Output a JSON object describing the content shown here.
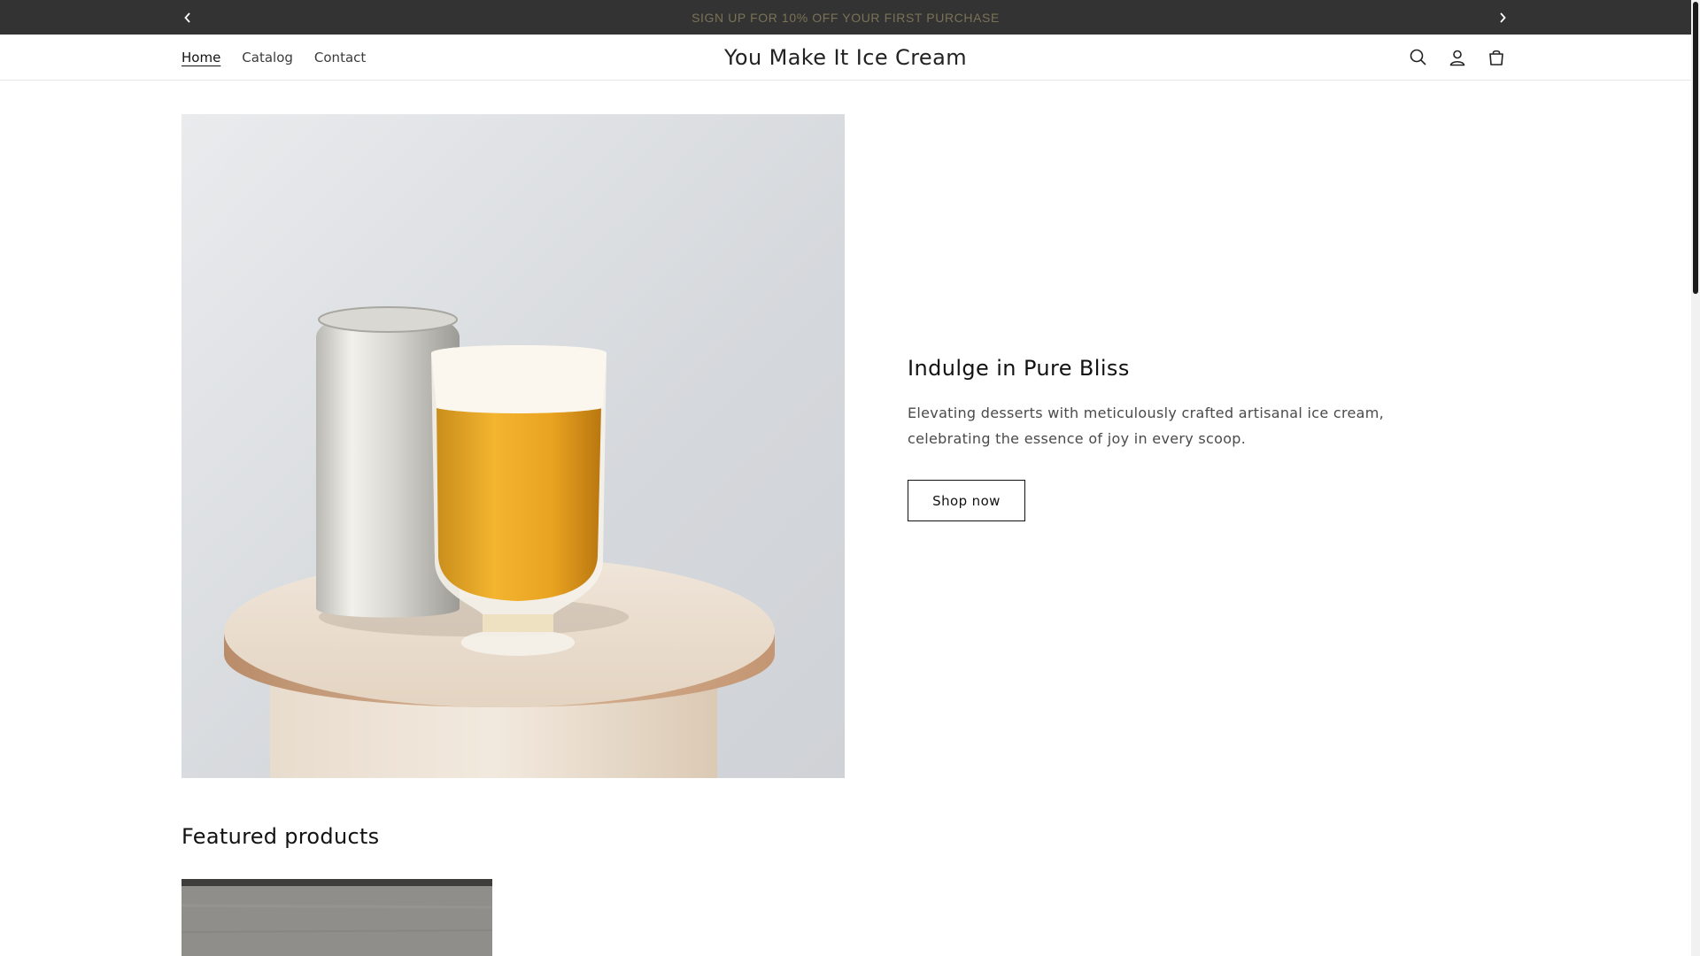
{
  "announcement": {
    "message": "SIGN UP FOR 10% OFF YOUR FIRST PURCHASE",
    "prev_icon": "chevron-left-icon",
    "next_icon": "chevron-right-icon",
    "background": "#333333",
    "text_color": "#7a7256"
  },
  "header": {
    "logo": "You Make It Ice Cream",
    "nav": [
      {
        "label": "Home",
        "active": true
      },
      {
        "label": "Catalog",
        "active": false
      },
      {
        "label": "Contact",
        "active": false
      }
    ],
    "icons": [
      "search-icon",
      "account-icon",
      "cart-icon"
    ]
  },
  "hero": {
    "image": "can-and-glass-of-beer-on-wooden-stand",
    "title": "Indulge in Pure Bliss",
    "description": "Elevating desserts with meticulously crafted artisanal ice cream, celebrating the essence of joy in every scoop.",
    "button_label": "Shop now"
  },
  "featured": {
    "title": "Featured products",
    "products": [
      {
        "image": "product-image-gray-surface"
      }
    ]
  }
}
